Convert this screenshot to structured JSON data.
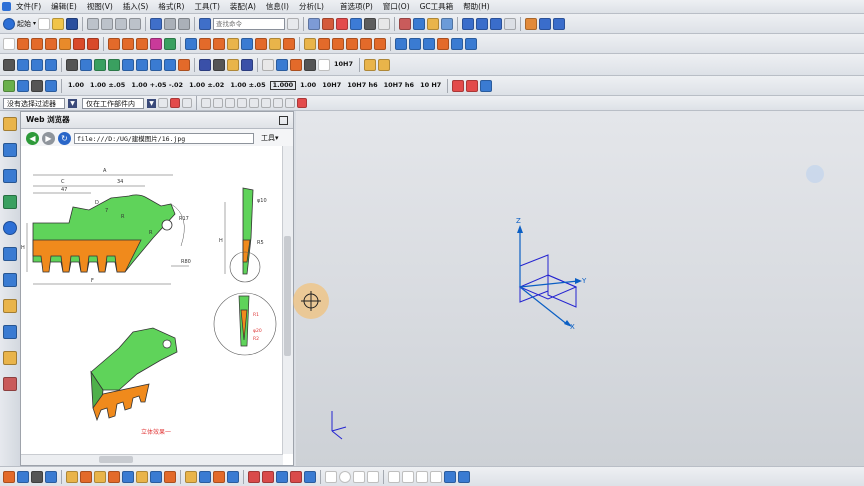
{
  "menubar": {
    "items": [
      "文件(F)",
      "编辑(E)",
      "视图(V)",
      "插入(S)",
      "格式(R)",
      "工具(T)",
      "装配(A)",
      "信息(I)",
      "分析(L)",
      "首选项(P)",
      "窗口(O)",
      "GC工具箱",
      "帮助(H)"
    ]
  },
  "toolbar": {
    "start_label": "起始",
    "search_placeholder": "查找命令",
    "numeric_buttons": [
      "1.00",
      "1.00 ±.05",
      "1.00 +.05 -.02",
      "1.00 ±.02",
      "1.00 ±.05",
      "1.000",
      "1.00",
      "10H7",
      "10H7 h6",
      "10H7 h6",
      "10 H7"
    ]
  },
  "selection_bar": {
    "filter_value": "没有选择过滤器",
    "scope_value": "仅在工作部件内"
  },
  "web_browser": {
    "title": "Web 浏览器",
    "address": "file:///D:/UG/建模图片/16.jpg",
    "tools_menu": "工具"
  },
  "drawing": {
    "dimension_labels": [
      "A",
      "C",
      "47",
      "34",
      "D",
      "7",
      "R17",
      "R",
      "R",
      "F",
      "H",
      "R80",
      "φ10",
      "R5",
      "φ20",
      "R1",
      "R2"
    ],
    "caption": "立体效果一"
  },
  "viewport": {
    "axis_labels": {
      "z": "Z",
      "y": "Y",
      "x": "X"
    }
  },
  "colors": {
    "orange": "#f08a1c",
    "green": "#5fd35a",
    "datum_blue": "#2424d0",
    "arrow_blue": "#0b5fc4"
  }
}
